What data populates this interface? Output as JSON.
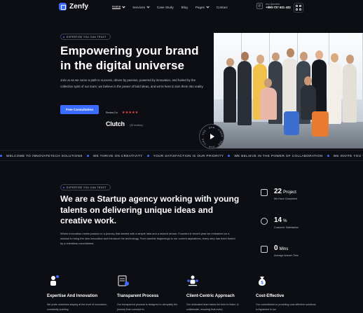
{
  "brand": {
    "name": "Zenfy",
    "accent": "#3b6cff",
    "background": "#0c0e14"
  },
  "nav": {
    "items": [
      {
        "label": "Home",
        "has_dropdown": true,
        "active": true
      },
      {
        "label": "Services",
        "has_dropdown": true,
        "active": false
      },
      {
        "label": "Case Study",
        "has_dropdown": false,
        "active": false
      },
      {
        "label": "Blog",
        "has_dropdown": false,
        "active": false
      },
      {
        "label": "Pages",
        "has_dropdown": true,
        "active": false
      },
      {
        "label": "Contact",
        "has_dropdown": false,
        "active": false
      }
    ]
  },
  "header_contact": {
    "label": "Any Question",
    "phone": "+990-737 621 432",
    "icon": "phone-icon"
  },
  "hero": {
    "badge": "EXPERTISE YOU CAN TRUST",
    "title": "Empowering your brand in the digital universe",
    "description": "Join us as we carve a path to success, driven by passion, powered by innovation, and fueled by the collective spirit of our team. we believe in the power of bold ideas, and we're here to turn them into reality.",
    "cta_label": "Free Consultation",
    "review": {
      "label": "Review On",
      "stars": 5,
      "platform": "Clutch",
      "count_text": "(30 reviews)"
    },
    "star_color": "#ff4d4d",
    "play_ring_text": "· SEE · OUR · VIDEO · SEE · OUR · VIDEO "
  },
  "ticker": {
    "items": [
      "WELCOME TO INNOVATETECH SOLUTIONS",
      "WE THRIVE ON CREATIVITY",
      "YOUR SATISFACTION IS OUR PRIORITY",
      "WE BELIEVE IN THE POWER OF COLLABORATION",
      "WE INVITE YOU TO JOIN US"
    ]
  },
  "about": {
    "badge": "EXPERTISE YOU CAN TRUST",
    "title": "We are a Startup agency working with young talents on delivering unique ideas and creative work.",
    "description": "Where innovation meets passion in a journey that started with a simple idea and a shared dream. Founded in recent year we embarked on a mission to bring the new innovation and introduce the technology. From humble beginnings to our current aspirations, every step has been fueled by a relentless commitment."
  },
  "stats": [
    {
      "value": "22",
      "unit": "Project",
      "label": "We Have Completed",
      "icon": "projects-icon"
    },
    {
      "value": "14",
      "unit": "%",
      "label": "Customer Satisfaction",
      "icon": "satisfaction-icon"
    },
    {
      "value": "0",
      "unit": "Mins",
      "label": "Average Answer Time",
      "icon": "clock-icon"
    }
  ],
  "features": [
    {
      "title": "Expertise And Innovation",
      "description": "We pride ourselves staying at the front of innovation, constantly pushing",
      "icon": "idea-person-icon"
    },
    {
      "title": "Transparent Process",
      "description": "Our transparent process is designed to demystify the journey from concept to",
      "icon": "checklist-icon"
    },
    {
      "title": "Client-Centric Approach",
      "description": "Our dedicated team takes the time to listen, & collaborate, ensuring that every",
      "icon": "team-icon"
    },
    {
      "title": "Cost-Effective",
      "description": "Our commitment to providing cost-effective solutions is ingrained in our",
      "icon": "money-bag-icon"
    }
  ]
}
